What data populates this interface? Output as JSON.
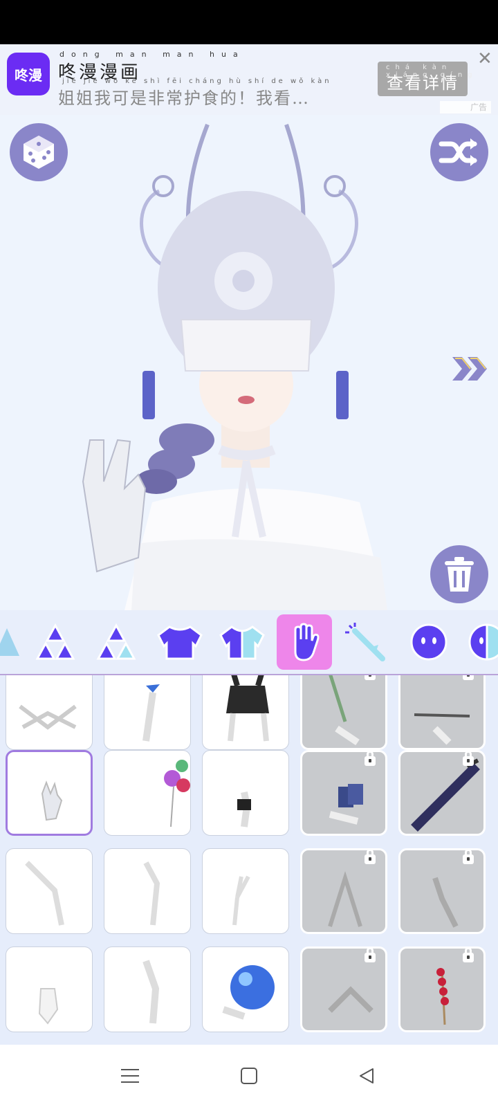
{
  "ad": {
    "logo_text": "咚漫",
    "title_pinyin": "dong man man hua",
    "title": "咚漫漫画",
    "desc_pinyin": "jiě jiě wǒ kě shì fēi cháng hù shí de wǒ kàn",
    "description": "姐姐我可是非常护食的！我看…",
    "cta_pinyin": "chá kàn xiáng qíng",
    "cta_label": "查看详情",
    "close_label": "✕",
    "tag_label": "广告"
  },
  "canvas": {
    "random_icon": "dice-icon",
    "shuffle_icon": "shuffle-icon",
    "delete_icon": "trash-icon",
    "next_icon": "double-chevron-right-icon"
  },
  "categories": [
    {
      "name": "partial-item",
      "icon": "partial-icon"
    },
    {
      "name": "triforce-full",
      "icon": "triangles-icon"
    },
    {
      "name": "triforce-half",
      "icon": "triangles-half-icon"
    },
    {
      "name": "top",
      "icon": "sweater-icon"
    },
    {
      "name": "top-half",
      "icon": "sweater-half-icon"
    },
    {
      "name": "hands",
      "icon": "hand-icon",
      "selected": true
    },
    {
      "name": "wand",
      "icon": "wand-icon"
    },
    {
      "name": "face",
      "icon": "face-icon"
    },
    {
      "name": "face-half",
      "icon": "face-half-icon"
    }
  ],
  "items": [
    {
      "name": "crossed-arms",
      "locked": false
    },
    {
      "name": "butterfly-hand",
      "locked": false
    },
    {
      "name": "mask-hands",
      "locked": false
    },
    {
      "name": "feather-hand",
      "locked": true
    },
    {
      "name": "brush-hand",
      "locked": true
    },
    {
      "name": "glove-wave",
      "locked": false,
      "selected": true
    },
    {
      "name": "balloons",
      "locked": false
    },
    {
      "name": "dark-hand",
      "locked": false
    },
    {
      "name": "cards",
      "locked": true
    },
    {
      "name": "guitar",
      "locked": true
    },
    {
      "name": "peace-arms",
      "locked": false
    },
    {
      "name": "point-hands",
      "locked": false
    },
    {
      "name": "v-sign",
      "locked": false
    },
    {
      "name": "prayer",
      "locked": true
    },
    {
      "name": "clasped",
      "locked": true
    },
    {
      "name": "fist",
      "locked": false
    },
    {
      "name": "pointing-up",
      "locked": false
    },
    {
      "name": "crystal-ball",
      "locked": false
    },
    {
      "name": "folded-hands",
      "locked": true
    },
    {
      "name": "candied-haws",
      "locked": true
    }
  ],
  "nav": {
    "menu_icon": "menu-icon",
    "home_icon": "home-icon",
    "back_icon": "back-icon"
  },
  "colors": {
    "accent": "#6b2cf3",
    "button": "#8a86c9",
    "selected_tab": "#ee86ea",
    "category_icon": "#5b3ff0"
  }
}
